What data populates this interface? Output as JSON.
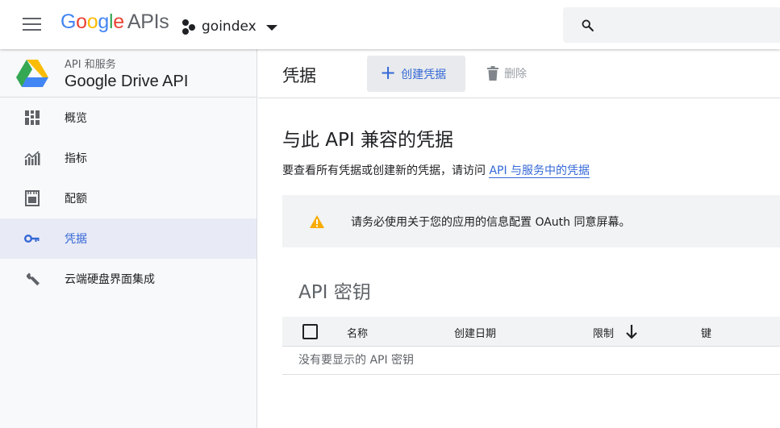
{
  "header": {
    "logo_google": "Google",
    "logo_apis": "APIs",
    "project_name": "goindex"
  },
  "sidebar": {
    "subtitle": "API 和服务",
    "title": "Google Drive API",
    "items": [
      {
        "label": "概览",
        "icon": "dashboard-icon",
        "active": false
      },
      {
        "label": "指标",
        "icon": "metrics-chart-icon",
        "active": false
      },
      {
        "label": "配额",
        "icon": "quota-icon",
        "active": false
      },
      {
        "label": "凭据",
        "icon": "key-icon",
        "active": true
      },
      {
        "label": "云端硬盘界面集成",
        "icon": "wrench-icon",
        "active": false
      }
    ]
  },
  "main": {
    "page_title": "凭据",
    "create_button": "创建凭据",
    "delete_button": "删除",
    "section_title": "与此 API 兼容的凭据",
    "section_desc_prefix": "要查看所有凭据或创建新的凭据，请访问 ",
    "section_desc_link": "API 与服务中的凭据",
    "notice_text": "请务必使用关于您的应用的信息配置 OAuth 同意屏幕。",
    "api_keys_title": "API 密钥",
    "table": {
      "columns": [
        "名称",
        "创建日期",
        "限制",
        "键"
      ],
      "empty_text": "没有要显示的 API 密钥"
    }
  },
  "colors": {
    "accent": "#3367d6",
    "warning": "#f9ab00",
    "active_bg": "#e8eaf6"
  }
}
